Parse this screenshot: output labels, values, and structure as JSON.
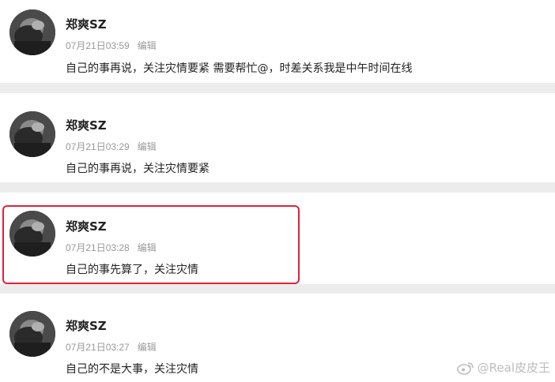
{
  "comments": [
    {
      "username": "郑爽SZ",
      "time": "07月21日03:59",
      "edit_label": "编辑",
      "text": "自己的事再说，关注灾情要紧 需要帮忙@，时差关系我是中午时间在线",
      "highlighted": false
    },
    {
      "username": "郑爽SZ",
      "time": "07月21日03:29",
      "edit_label": "编辑",
      "text": "自己的事再说，关注灾情要紧",
      "highlighted": false
    },
    {
      "username": "郑爽SZ",
      "time": "07月21日03:28",
      "edit_label": "编辑",
      "text": "自己的事先算了，关注灾情",
      "highlighted": true
    },
    {
      "username": "郑爽SZ",
      "time": "07月21日03:27",
      "edit_label": "编辑",
      "text": "自己的不是大事，关注灾情",
      "highlighted": false
    }
  ],
  "watermark": {
    "text": "@Real皮皮王",
    "icon": "weibo-logo-icon"
  },
  "colors": {
    "highlight_border": "#e0223a",
    "meta_text": "#999999",
    "background": "#ececec"
  }
}
